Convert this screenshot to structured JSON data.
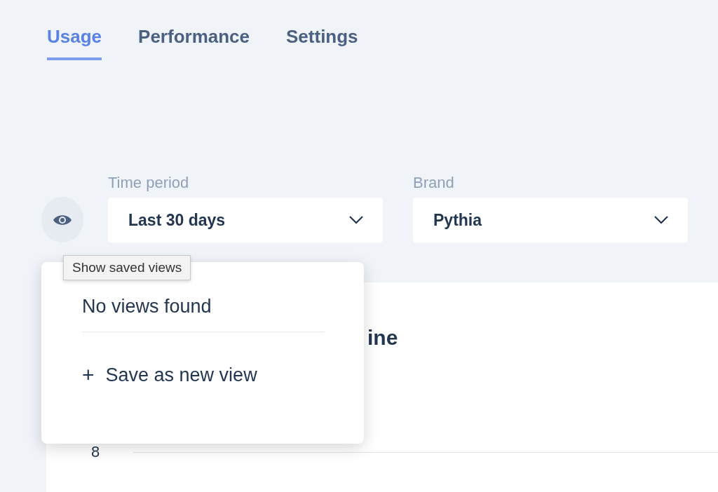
{
  "tabs": [
    {
      "label": "Usage",
      "selected": true
    },
    {
      "label": "Performance",
      "selected": false
    },
    {
      "label": "Settings",
      "selected": false
    }
  ],
  "filters": [
    {
      "label": "Time period",
      "value": "Last 30 days"
    },
    {
      "label": "Brand",
      "value": "Pythia"
    }
  ],
  "saved_views_tooltip": "Show saved views",
  "saved_views_menu": {
    "empty_message": "No views found",
    "action_icon": "+",
    "action_label": "Save as new view"
  },
  "chart_card": {
    "title": "ine",
    "y_tick": "8"
  }
}
